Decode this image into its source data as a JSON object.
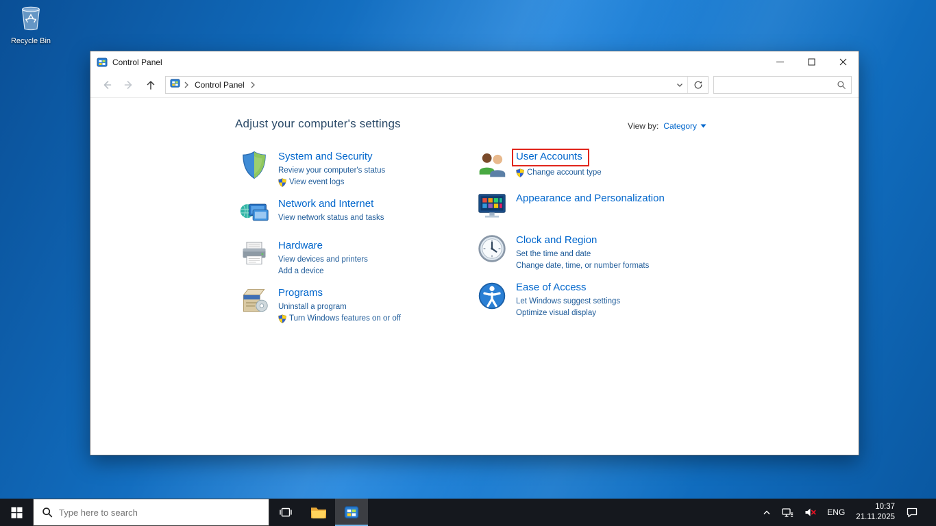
{
  "colors": {
    "category_link": "#0066cc",
    "task_link": "#1e5b99",
    "heading_text": "#2b4a68",
    "highlight_box": "#e1251b",
    "desktop_blue": "#1272c6",
    "taskbar_bg": "#15181e"
  },
  "desktop": {
    "recycle_bin_label": "Recycle Bin"
  },
  "window": {
    "title": "Control Panel",
    "breadcrumb_root": "Control Panel",
    "search_value": "",
    "heading": "Adjust your computer's settings",
    "view_by": {
      "label": "View by:",
      "value": "Category"
    },
    "left_categories": [
      {
        "title": "System and Security",
        "icon": "system-and-security-icon",
        "links": [
          {
            "label": "Review your computer's status",
            "shield": false
          },
          {
            "label": "View event logs",
            "shield": true
          }
        ]
      },
      {
        "title": "Network and Internet",
        "icon": "network-and-internet-icon",
        "links": [
          {
            "label": "View network status and tasks",
            "shield": false
          }
        ]
      },
      {
        "title": "Hardware",
        "icon": "hardware-icon",
        "links": [
          {
            "label": "View devices and printers",
            "shield": false
          },
          {
            "label": "Add a device",
            "shield": false
          }
        ]
      },
      {
        "title": "Programs",
        "icon": "programs-icon",
        "links": [
          {
            "label": "Uninstall a program",
            "shield": false
          },
          {
            "label": "Turn Windows features on or off",
            "shield": true
          }
        ]
      }
    ],
    "right_categories": [
      {
        "title": "User Accounts",
        "icon": "user-accounts-icon",
        "highlighted": true,
        "links": [
          {
            "label": "Change account type",
            "shield": true
          }
        ]
      },
      {
        "title": "Appearance and Personalization",
        "icon": "appearance-personalization-icon",
        "links": []
      },
      {
        "title": "Clock and Region",
        "icon": "clock-and-region-icon",
        "links": [
          {
            "label": "Set the time and date",
            "shield": false
          },
          {
            "label": "Change date, time, or number formats",
            "shield": false
          }
        ]
      },
      {
        "title": "Ease of Access",
        "icon": "ease-of-access-icon",
        "links": [
          {
            "label": "Let Windows suggest settings",
            "shield": false
          },
          {
            "label": "Optimize visual display",
            "shield": false
          }
        ]
      }
    ]
  },
  "taskbar": {
    "search_placeholder": "Type here to search",
    "tray": {
      "language": "ENG",
      "time": "10:37",
      "date": "21.11.2025"
    }
  }
}
